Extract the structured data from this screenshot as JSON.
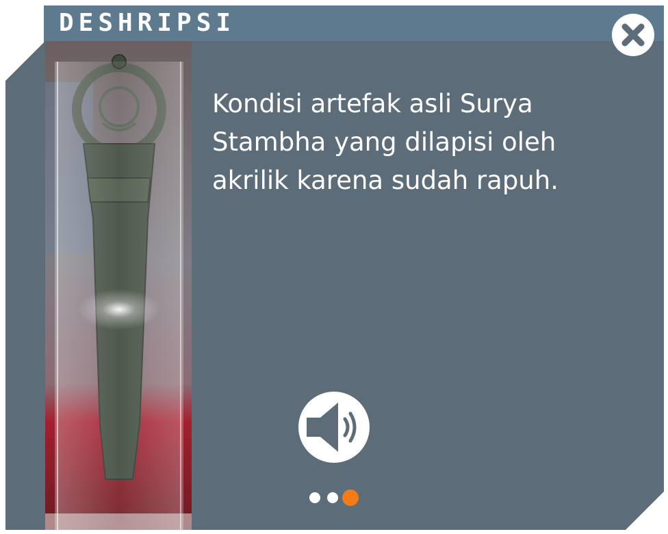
{
  "header": {
    "title": "DESHRIPSI"
  },
  "close_button": {
    "icon": "close-icon"
  },
  "photo": {
    "subject": "artefak-surya-stambha",
    "icon": "artifact-photo"
  },
  "description": {
    "text": "Kondisi artefak asli Surya Stambha yang dilapisi oleh akrilik karena sudah rapuh."
  },
  "audio_button": {
    "icon": "speaker-icon"
  },
  "pagination": {
    "total": 3,
    "current": 3,
    "active_color": "#f47b16",
    "inactive_color": "#ffffff"
  },
  "colors": {
    "panel": "#5c6c78",
    "titlebar": "#5e7a8e",
    "text": "#ffffff"
  }
}
